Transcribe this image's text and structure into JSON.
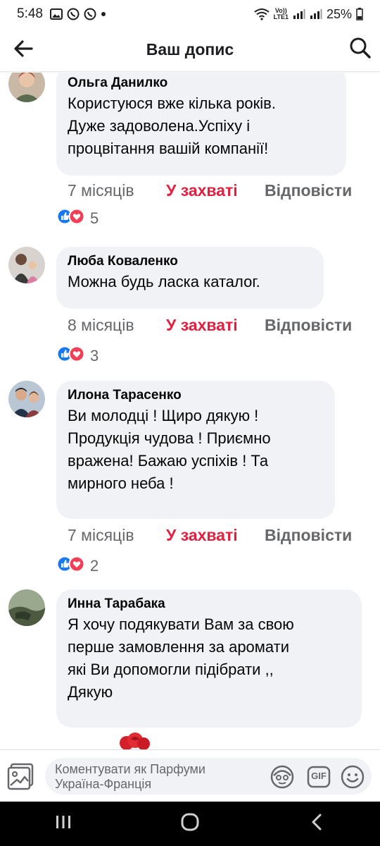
{
  "status": {
    "time": "5:48",
    "net_top": "Vo))",
    "net_bottom": "LTE1",
    "battery": "25%"
  },
  "header": {
    "title": "Ваш допис"
  },
  "comments": [
    {
      "author": "Ольга Данилко",
      "lines": [
        "Користуюся вже кілька років.",
        "Дуже задоволена.Успіху і",
        "процвітання вашій компанії!"
      ],
      "time": "7 місяців",
      "reaction": "У захваті",
      "reply": "Відповісти",
      "count": "5"
    },
    {
      "author": "Люба Коваленко",
      "lines": [
        "Можна будь ласка каталог."
      ],
      "time": "8 місяців",
      "reaction": "У захваті",
      "reply": "Відповісти",
      "count": "3"
    },
    {
      "author": "Илона Тарасенко",
      "lines": [
        "Ви молодці ! Щиро дякую !",
        "Продукція чудова ! Приємно",
        "вражена! Бажаю успіхів ! Та",
        "мирного неба !"
      ],
      "time": "7 місяців",
      "reaction": "У захваті",
      "reply": "Відповісти",
      "count": "2"
    },
    {
      "author": "Инна Тарабака",
      "lines": [
        "Я хочу подякувати Вам за свою",
        "перше замовлення за аромати",
        "які Ви допомогли підібрати ,,",
        "Дякую"
      ]
    }
  ],
  "composer": {
    "placeholder_line1": "Коментувати як Парфуми",
    "placeholder_line2": "Україна-Франція",
    "gif_label": "GIF"
  },
  "colors": {
    "reaction_red": "#e41e3f",
    "like_blue": "#1877f2",
    "meta_gray": "#65676b",
    "bubble_bg": "#f0f2f5"
  },
  "icons": {
    "back": "arrow-left-icon",
    "search": "search-icon",
    "photo": "photo-icon",
    "avatar_sticker": "avatar-sticker-icon",
    "gif": "gif-icon",
    "emoji": "smiley-icon"
  }
}
